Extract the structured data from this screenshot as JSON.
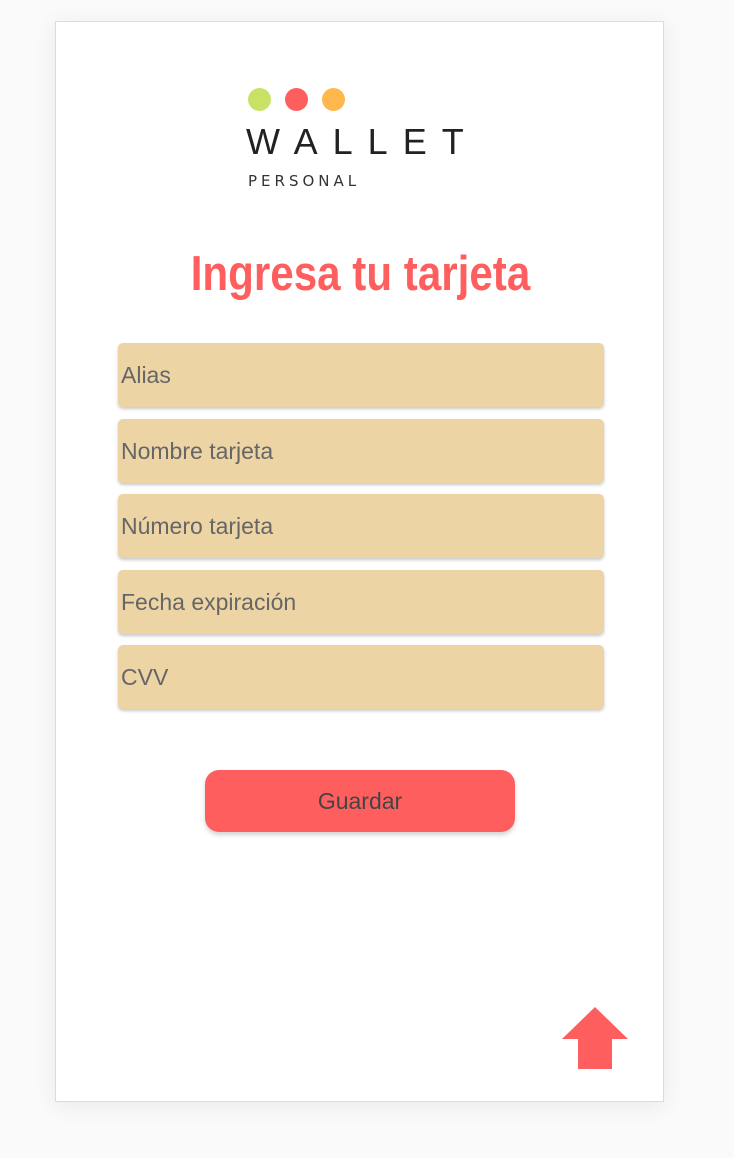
{
  "brand": {
    "name": "WALLET",
    "tagline": "PERSONAL",
    "dot_colors": [
      "#c9e265",
      "#ff5e5e",
      "#ffb84d"
    ]
  },
  "page": {
    "title": "Ingresa tu tarjeta"
  },
  "form": {
    "fields": [
      {
        "placeholder": "Alias",
        "value": ""
      },
      {
        "placeholder": "Nombre tarjeta",
        "value": ""
      },
      {
        "placeholder": "Número tarjeta",
        "value": ""
      },
      {
        "placeholder": "Fecha expiración",
        "value": ""
      },
      {
        "placeholder": "CVV",
        "value": ""
      }
    ],
    "submit_label": "Guardar"
  },
  "nav": {
    "scroll_top_icon": "up-arrow-icon"
  },
  "colors": {
    "accent": "#ff5e5e",
    "field_background": "#edd4a5",
    "button_background": "#ff5e5e",
    "page_background": "#ffffff"
  }
}
